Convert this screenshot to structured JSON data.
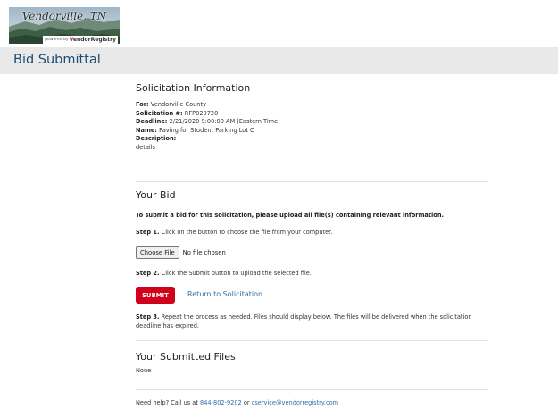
{
  "logo": {
    "title": "Vendorville, TN",
    "powered_by": "powered by",
    "brand_prefix": "V",
    "brand_rest": "endorRegistry",
    "colors": {
      "brand_red": "#c8102e"
    }
  },
  "banner": {
    "title": "Bid Submittal"
  },
  "solicitation": {
    "heading": "Solicitation Information",
    "for_label": "For:",
    "for_value": "Vendorville County",
    "number_label": "Solicitation #:",
    "number_value": "RFP020720",
    "deadline_label": "Deadline:",
    "deadline_value": "2/21/2020 9:00:00 AM (Eastern Time)",
    "name_label": "Name:",
    "name_value": "Paving for Student Parking Lot C",
    "description_label": "Description:",
    "description_value": "details"
  },
  "bid": {
    "heading": "Your Bid",
    "intro": "To submit a bid for this solicitation, please upload all file(s) containing relevant information.",
    "step1_label": "Step 1.",
    "step1_text": "Click on the button to choose the file from your computer.",
    "choose_file_label": "Choose File",
    "no_file_text": "No file chosen",
    "step2_label": "Step 2.",
    "step2_text": "Click the Submit button to upload the selected file.",
    "submit_label": "SUBMIT",
    "return_label": "Return to Solicitation",
    "step3_label": "Step 3.",
    "step3_text": "Repeat the process as needed. Files should display below. The files will be delivered when the solicitation deadline has expired."
  },
  "files": {
    "heading": "Your Submitted Files",
    "none_text": "None"
  },
  "help": {
    "prefix": "Need help? Call us at",
    "phone": "844-802-9202",
    "or": "or",
    "email": "cservice@vendorregistry.com"
  },
  "colors": {
    "banner_bg": "#e9e9e9",
    "banner_text": "#1d4d6e",
    "submit_bg": "#d0021b",
    "link": "#2f6fa6"
  }
}
